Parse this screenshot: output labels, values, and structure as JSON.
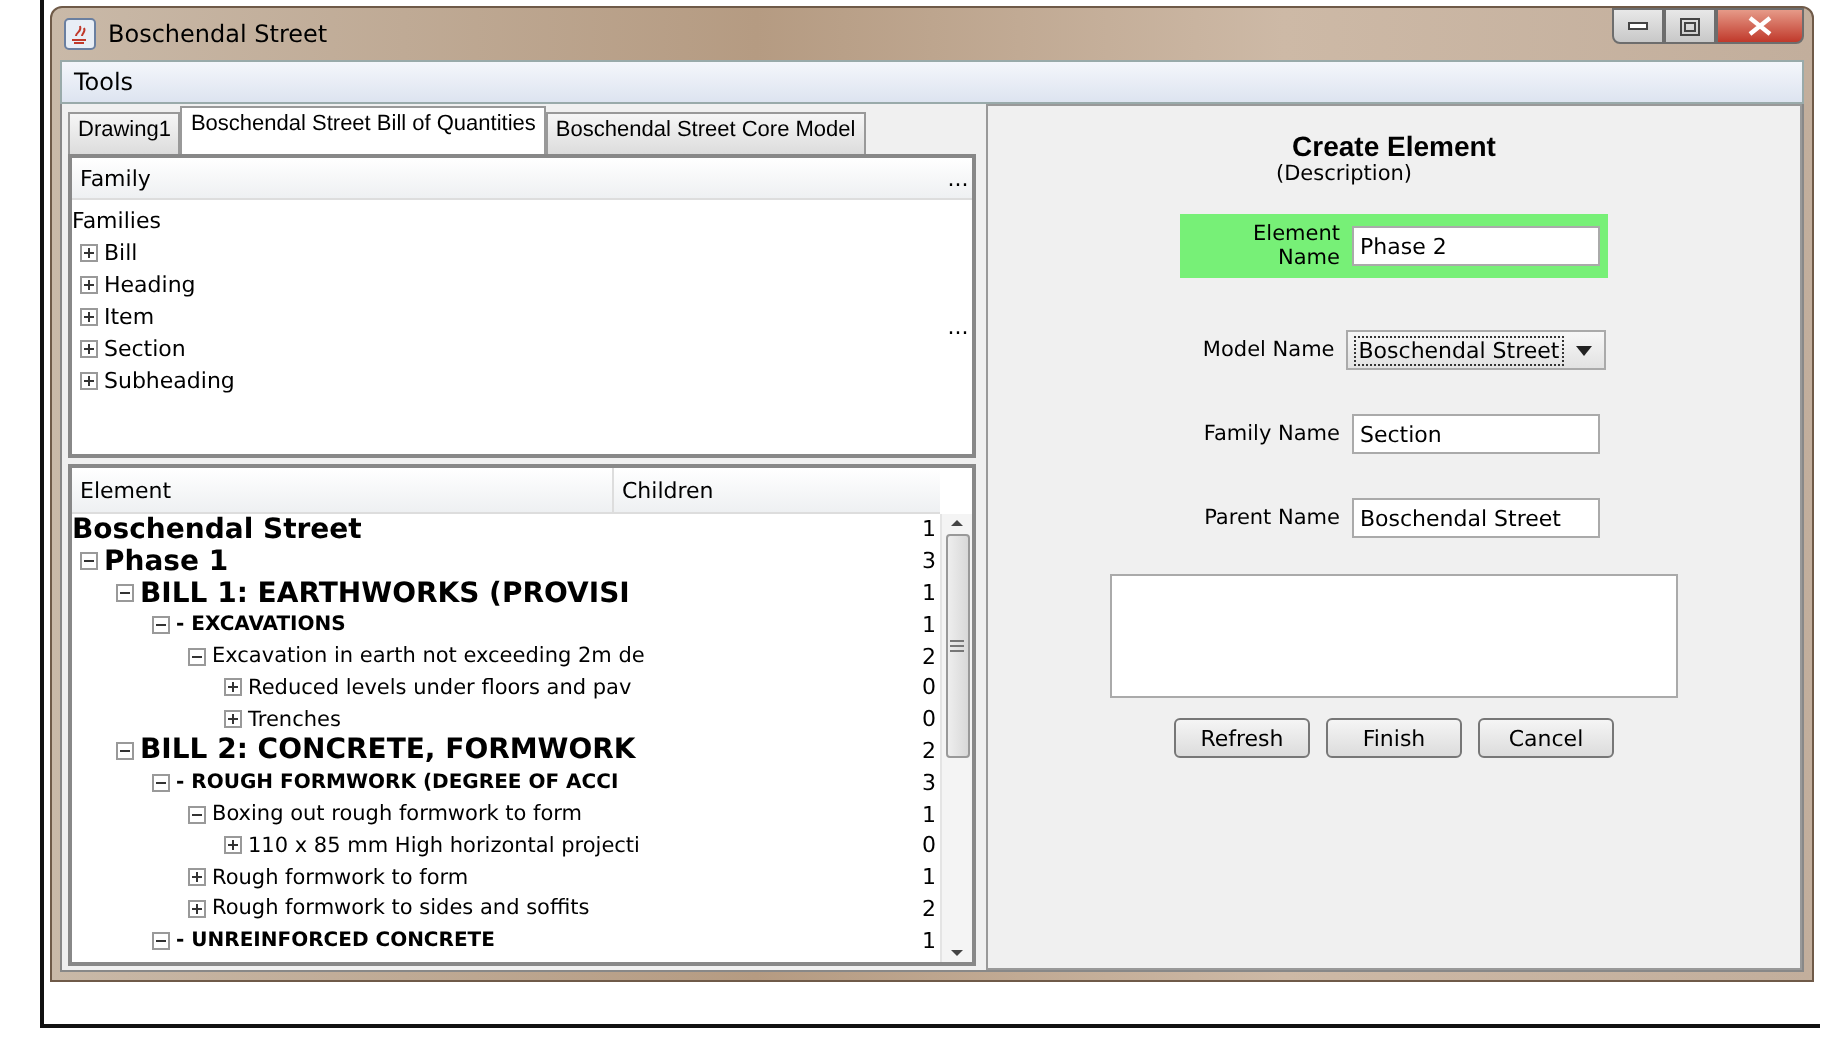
{
  "window": {
    "title": "Boschendal Street"
  },
  "menu": [
    "Tools"
  ],
  "tabs": [
    {
      "label": "Drawing1",
      "selected": false
    },
    {
      "label": "Boschendal Street Bill of Quantities",
      "selected": true
    },
    {
      "label": "Boschendal Street Core Model",
      "selected": false
    }
  ],
  "family_table": {
    "column": "Family",
    "column_more": "...",
    "row_more": "...",
    "root": "Families",
    "items": [
      {
        "label": "Bill",
        "expanded": false
      },
      {
        "label": "Heading",
        "expanded": false
      },
      {
        "label": "Item",
        "expanded": false
      },
      {
        "label": "Section",
        "expanded": false
      },
      {
        "label": "Subheading",
        "expanded": false
      }
    ]
  },
  "element_table": {
    "columns": [
      "Element",
      "Children"
    ],
    "rows": [
      {
        "name": "Boschendal Street",
        "children_count": "1",
        "kind": "title",
        "children": [
          {
            "name": "Phase 1",
            "children_count": "3",
            "kind": "title",
            "expanded": true,
            "children": [
              {
                "name": "BILL 1: EARTHWORKS (PROVISI",
                "children_count": "1",
                "kind": "title",
                "expanded": true,
                "children": [
                  {
                    "name": "- EXCAVATIONS",
                    "children_count": "1",
                    "kind": "heading",
                    "expanded": true,
                    "children": [
                      {
                        "name": "Excavation in earth not exceeding 2m de",
                        "children_count": "2",
                        "kind": "item",
                        "expanded": true,
                        "children": [
                          {
                            "name": "Reduced levels under floors and pav",
                            "children_count": "0",
                            "kind": "item",
                            "expanded": false
                          },
                          {
                            "name": "Trenches",
                            "children_count": "0",
                            "kind": "item",
                            "expanded": false
                          }
                        ]
                      }
                    ]
                  }
                ]
              },
              {
                "name": "BILL 2: CONCRETE, FORMWORK",
                "children_count": "2",
                "kind": "title",
                "expanded": true,
                "children": [
                  {
                    "name": "- ROUGH FORMWORK (DEGREE OF ACCI",
                    "children_count": "3",
                    "kind": "heading",
                    "expanded": true,
                    "children": [
                      {
                        "name": "Boxing out rough formwork to form",
                        "children_count": "1",
                        "kind": "item",
                        "expanded": true,
                        "children": [
                          {
                            "name": "110 x 85 mm High horizontal projecti",
                            "children_count": "0",
                            "kind": "item",
                            "expanded": false
                          }
                        ]
                      },
                      {
                        "name": "Rough formwork to form",
                        "children_count": "1",
                        "kind": "item",
                        "expanded": false
                      },
                      {
                        "name": "Rough formwork to sides and soffits",
                        "children_count": "2",
                        "kind": "item",
                        "expanded": false
                      }
                    ]
                  },
                  {
                    "name": "- UNREINFORCED CONCRETE",
                    "children_count": "1",
                    "kind": "heading",
                    "expanded": true
                  }
                ]
              }
            ]
          }
        ]
      }
    ]
  },
  "form": {
    "title": "Create Element",
    "subtitle": "(Description)",
    "fields": [
      {
        "label": "Element Name",
        "value": "Phase 2",
        "kind": "text",
        "highlighted": true
      },
      {
        "label": "Model Name",
        "value": "Boschendal Street",
        "kind": "dropdown",
        "highlighted": false
      },
      {
        "label": "Family Name",
        "value": "Section",
        "kind": "text",
        "highlighted": false
      },
      {
        "label": "Parent Name",
        "value": "Boschendal Street",
        "kind": "text",
        "highlighted": false
      }
    ],
    "buttons": [
      "Refresh",
      "Finish",
      "Cancel"
    ]
  }
}
